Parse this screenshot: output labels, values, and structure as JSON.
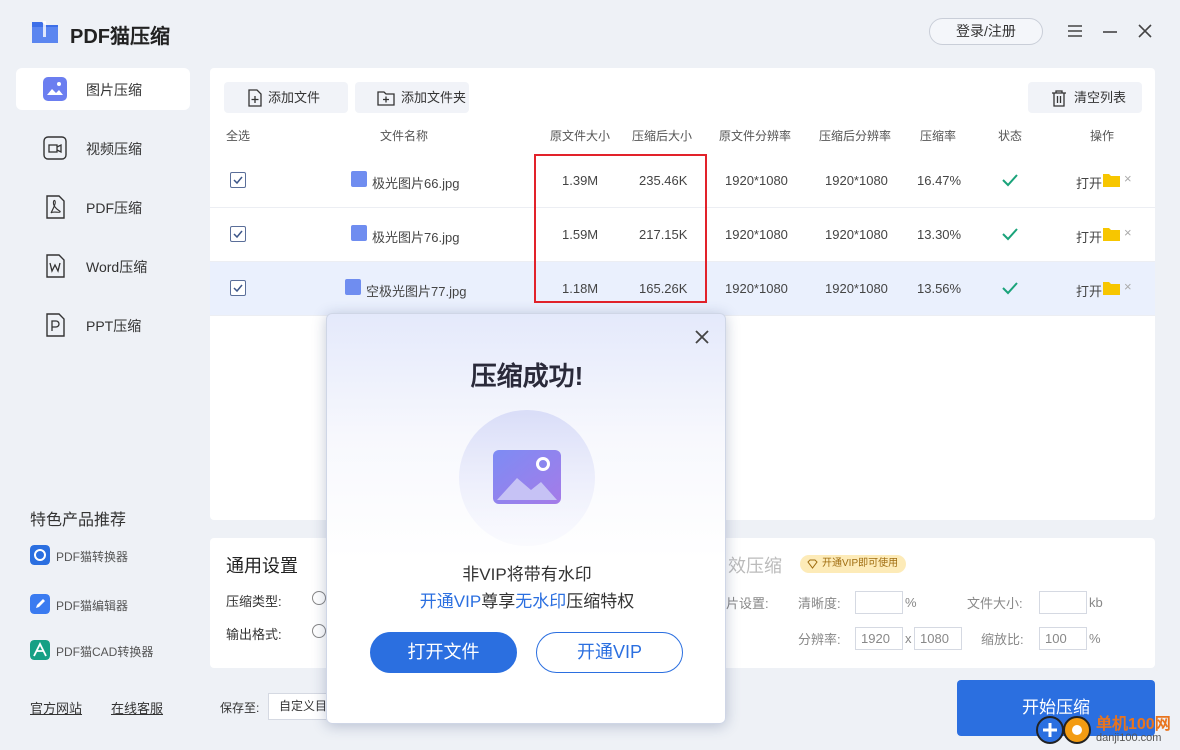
{
  "app": {
    "title": "PDF猫压缩",
    "login_label": "登录/注册"
  },
  "sidebar": {
    "items": [
      {
        "label": "图片压缩",
        "icon": "image-icon"
      },
      {
        "label": "视频压缩",
        "icon": "video-icon"
      },
      {
        "label": "PDF压缩",
        "icon": "pdf-icon"
      },
      {
        "label": "Word压缩",
        "icon": "word-icon"
      },
      {
        "label": "PPT压缩",
        "icon": "ppt-icon"
      }
    ],
    "featured_title": "特色产品推荐",
    "featured": [
      {
        "label": "PDF猫转换器",
        "color": "#2b6fe0"
      },
      {
        "label": "PDF猫编辑器",
        "color": "#3a7bf0"
      },
      {
        "label": "PDF猫CAD转换器",
        "color": "#16a085"
      }
    ],
    "links": {
      "website": "官方网站",
      "support": "在线客服"
    }
  },
  "toolbar": {
    "add_file": "添加文件",
    "add_folder": "添加文件夹",
    "clear_list": "清空列表"
  },
  "table": {
    "headers": {
      "select_all": "全选",
      "file_name": "文件名称",
      "orig_size": "原文件大小",
      "comp_size": "压缩后大小",
      "orig_res": "原文件分辨率",
      "comp_res": "压缩后分辨率",
      "ratio": "压缩率",
      "status": "状态",
      "action": "操作"
    },
    "rows": [
      {
        "name": "极光图片66.jpg",
        "orig_size": "1.39M",
        "comp_size": "235.46K",
        "orig_res": "1920*1080",
        "comp_res": "1920*1080",
        "ratio": "16.47%",
        "open": "打开"
      },
      {
        "name": "极光图片76.jpg",
        "orig_size": "1.59M",
        "comp_size": "217.15K",
        "orig_res": "1920*1080",
        "comp_res": "1920*1080",
        "ratio": "13.30%",
        "open": "打开"
      },
      {
        "name": "空极光图片77.jpg",
        "orig_size": "1.18M",
        "comp_size": "165.26K",
        "orig_res": "1920*1080",
        "comp_res": "1920*1080",
        "ratio": "13.56%",
        "open": "打开"
      }
    ]
  },
  "settings": {
    "title": "通用设置",
    "compress_type_label": "压缩类型:",
    "output_format_label": "输出格式:",
    "efficient_title": "效压缩",
    "vip_badge": "开通VIP即可使用",
    "custom_settings_label": "片设置:",
    "clarity_label": "清晰度:",
    "clarity_unit": "%",
    "file_size_label": "文件大小:",
    "file_size_unit": "kb",
    "resolution_label": "分辨率:",
    "res_width": "1920",
    "res_x": "x",
    "res_height": "1080",
    "scale_label": "缩放比:",
    "scale_value": "100",
    "scale_unit": "%"
  },
  "save": {
    "label": "保存至:",
    "value": "自定义目"
  },
  "start_button": "开始压缩",
  "modal": {
    "title": "压缩成功!",
    "msg1": "非VIP将带有水印",
    "msg2_a": "开通VIP",
    "msg2_b": "尊享",
    "msg2_c": "无水印",
    "msg2_d": "压缩特权",
    "btn_open": "打开文件",
    "btn_vip": "开通VIP"
  },
  "watermark": {
    "site": "单机100网",
    "domain": "danji100.com"
  },
  "colors": {
    "accent": "#2b6fe0",
    "highlight_box": "#e2222a",
    "success": "#1aa37a"
  }
}
